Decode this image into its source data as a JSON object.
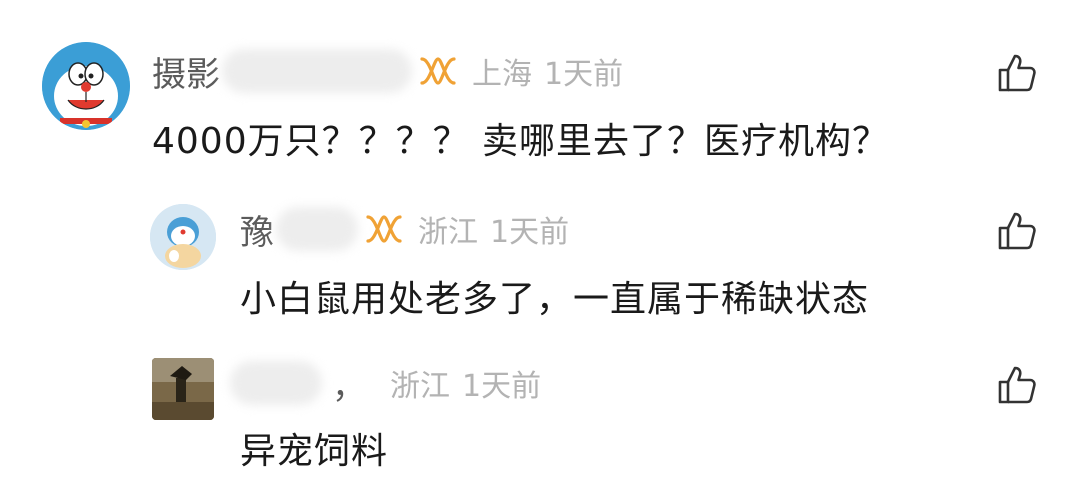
{
  "comments": [
    {
      "username": "摄影",
      "location": "上海",
      "time": "1天前",
      "text": "4000万只？？？？ 卖哪里去了？医疗机构？"
    },
    {
      "username": "豫",
      "location": "浙江",
      "time": "1天前",
      "text": "小白鼠用处老多了，一直属于稀缺状态"
    },
    {
      "username": "",
      "separator": "，",
      "location": "浙江",
      "time": "1天前",
      "text": "异宠饲料"
    }
  ],
  "icons": {
    "like": "thumbs-up-outline-icon",
    "badge": "gold-vip-badge-icon"
  },
  "colors": {
    "username": "#5b5b5b",
    "meta": "#b3b3b3",
    "text": "#1a1a1a",
    "badge": "#f0a235"
  }
}
